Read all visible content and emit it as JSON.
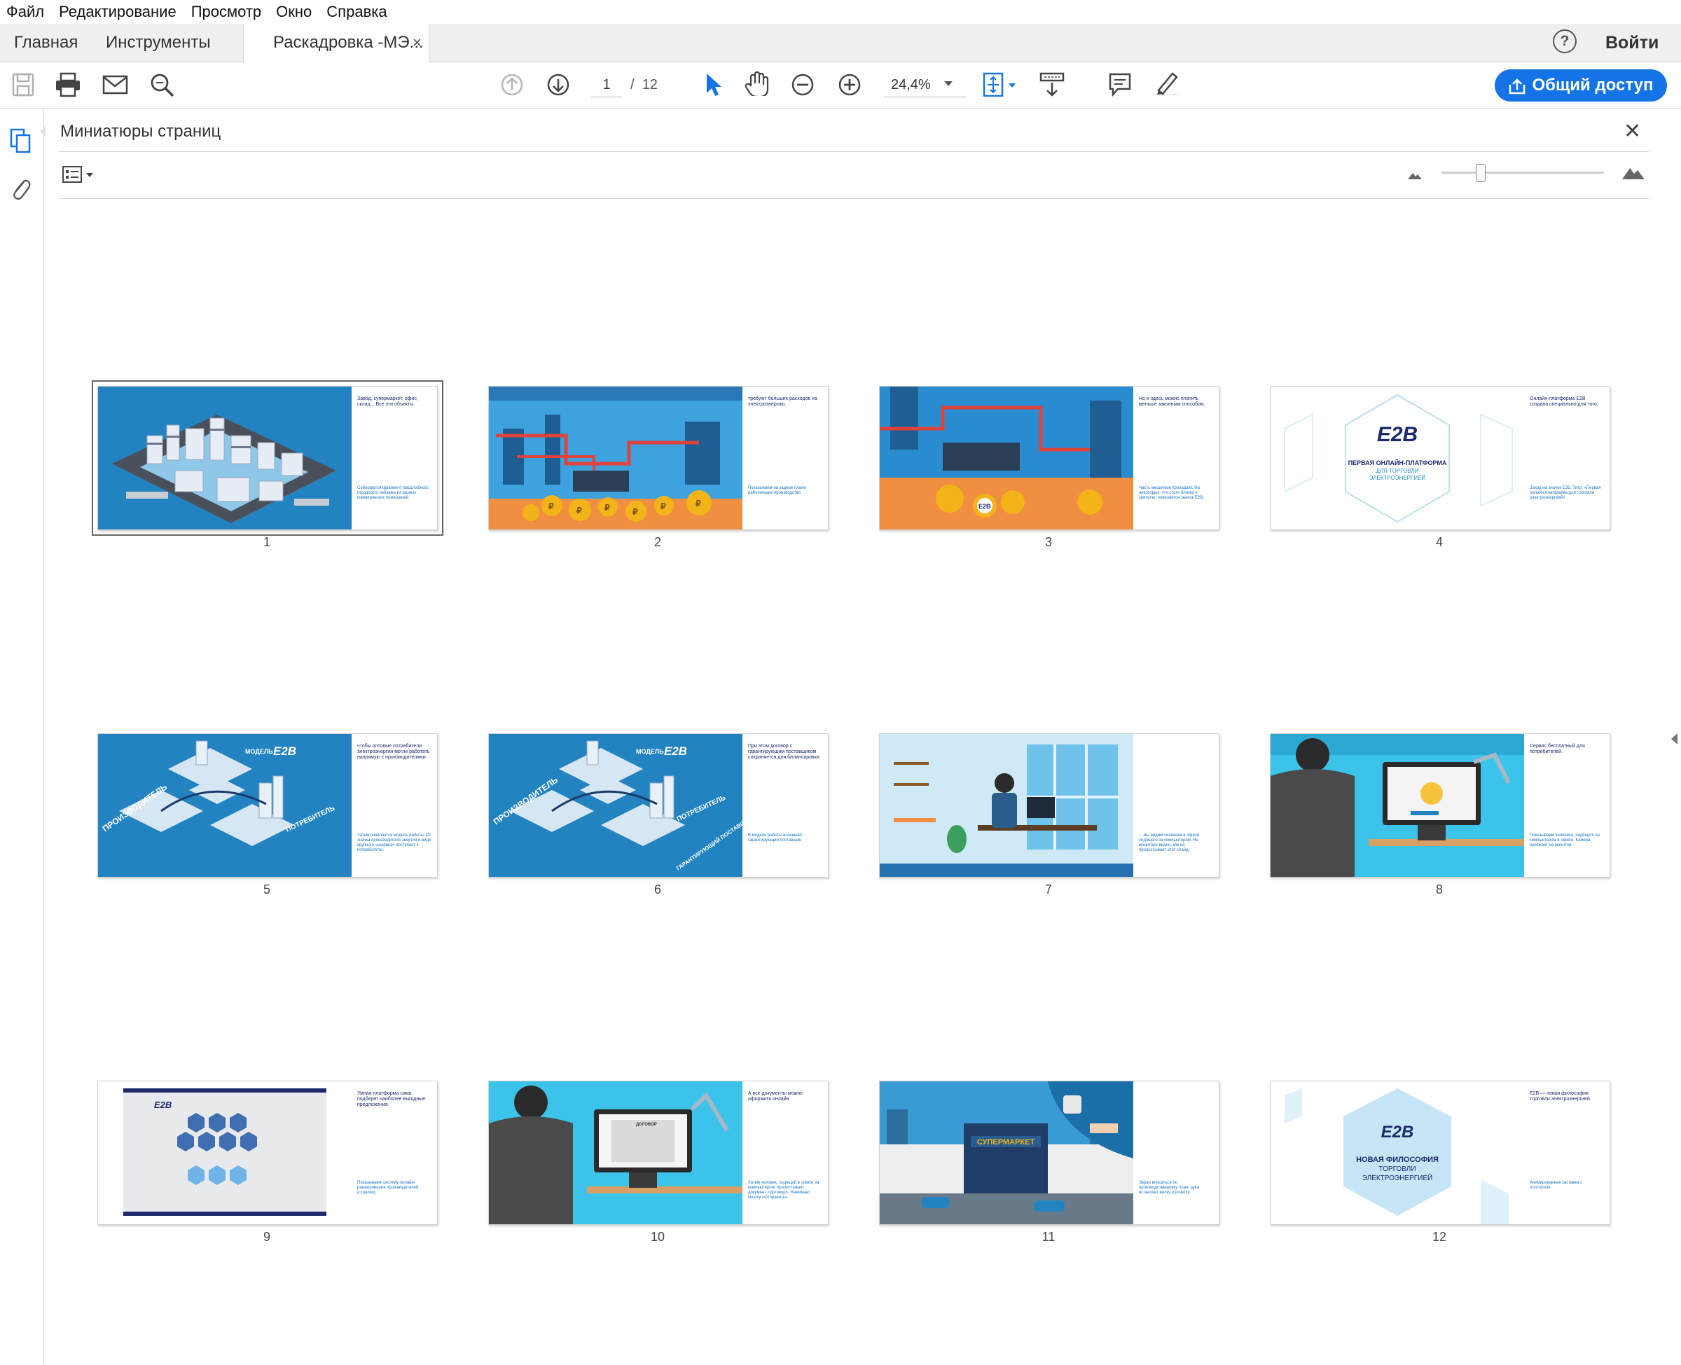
{
  "menu": [
    "Файл",
    "Редактирование",
    "Просмотр",
    "Окно",
    "Справка"
  ],
  "tabs": {
    "home": "Главная",
    "tools": "Инструменты",
    "document": "Раскадровка -МЭ...",
    "close": "×"
  },
  "header": {
    "help": "?",
    "signin": "Войти"
  },
  "toolbar": {
    "current_page": "1",
    "page_separator": "/",
    "total_pages": "12",
    "zoom": "24,4%",
    "share_label": "Общий доступ"
  },
  "panel": {
    "title": "Миниатюры страниц",
    "close": "✕"
  },
  "pages": [
    {
      "num": "1",
      "text_top": "Завод, супермаркет, офис, склад... Все эти объекты",
      "text_bottom": "Собираются фрагмент масштабного городского пейзажа из разных коммерческих помещений"
    },
    {
      "num": "2",
      "text_top": "требуют больших расходов на электроэнергию.",
      "text_bottom": "Показываем на задние плане работающее производство"
    },
    {
      "num": "3",
      "text_top": "Но и здесь можно платить меньше законным способом.",
      "text_bottom": "Часть мешочков пропадает. На некоторых, что стоят близко к зрителю, появляется значок E2B."
    },
    {
      "num": "4",
      "text_top": "Онлайн-платформа E2B создана специально для того,",
      "text_bottom": "Заход на значок E2B. Титр: «Первая онлайн-платформа для торговли электроэнергией»."
    },
    {
      "num": "5",
      "text_top": "чтобы оптовые потребители электроэнергии могли работать напрямую с производителями.",
      "text_bottom": "Затем появляется модель работы. От значка производителя энергия в виде крупного «шарика» поступает к потребителю."
    },
    {
      "num": "6",
      "text_top": "При этом договор с гарантирующим поставщиком сохраняется для балансировки.",
      "text_bottom": "В модели работы возникает гарантирующий поставщик."
    },
    {
      "num": "7",
      "text_top": "",
      "text_bottom": "... мы видим человека в офисе, сидящего за компьютером. Не мониторе видно, как он пролистывает этот слайд."
    },
    {
      "num": "8",
      "text_top": "Сервис бесплатный для потребителей.",
      "text_bottom": "Показываем человека, сидящего за компьютером в офисе. Камера наезжает на монитор."
    },
    {
      "num": "9",
      "text_top": "Умная платформа сама подберет наиболее выгодные предложения.",
      "text_bottom": "Показываем систему онлайн-ранжирования производителей (стрелки)."
    },
    {
      "num": "10",
      "text_top": "А все документы можно оформить онлайн.",
      "text_bottom": "Затем человек, сидящий в офисе за компьютером, пролистывает документ «Договор». Нажимает кнопку «Отправить»."
    },
    {
      "num": "11",
      "text_top": "",
      "text_bottom": "Экран вписаться по производственному план, рука вставляет вилку в розетку."
    },
    {
      "num": "12",
      "text_top": "E2B — новая философия торговли электроэнергией.",
      "text_bottom": "Анимированная заставка с логотипом."
    }
  ],
  "slide_titles": {
    "model_label": "МОДЕЛЬ",
    "brand": "E2B",
    "producer": "ПРОИЗВОДИТЕЛЬ",
    "consumer": "ПОТРЕБИТЕЛЬ",
    "guarantor": "ГАРАНТИРУЮЩИЙ ПОСТАВЩИК",
    "p4_line1": "ПЕРВАЯ ОНЛАЙН-ПЛАТФОРМА",
    "p4_line2": "ДЛЯ ТОРГОВЛИ",
    "p4_line3": "ЭЛЕКТРОЭНЕРГИЕЙ",
    "supermarket": "СУПЕРМАРКЕТ",
    "contract": "ДОГОВОР",
    "p12_line1": "НОВАЯ ФИЛОСОФИЯ",
    "p12_line2": "ТОРГОВЛИ",
    "p12_line3": "ЭЛЕКТРОЭНЕРГИЕЙ"
  },
  "colors": {
    "accent": "#1473e6",
    "slide_blue": "#2383c1",
    "bag_gold": "#f2b418",
    "pipe_red": "#e0433b"
  }
}
